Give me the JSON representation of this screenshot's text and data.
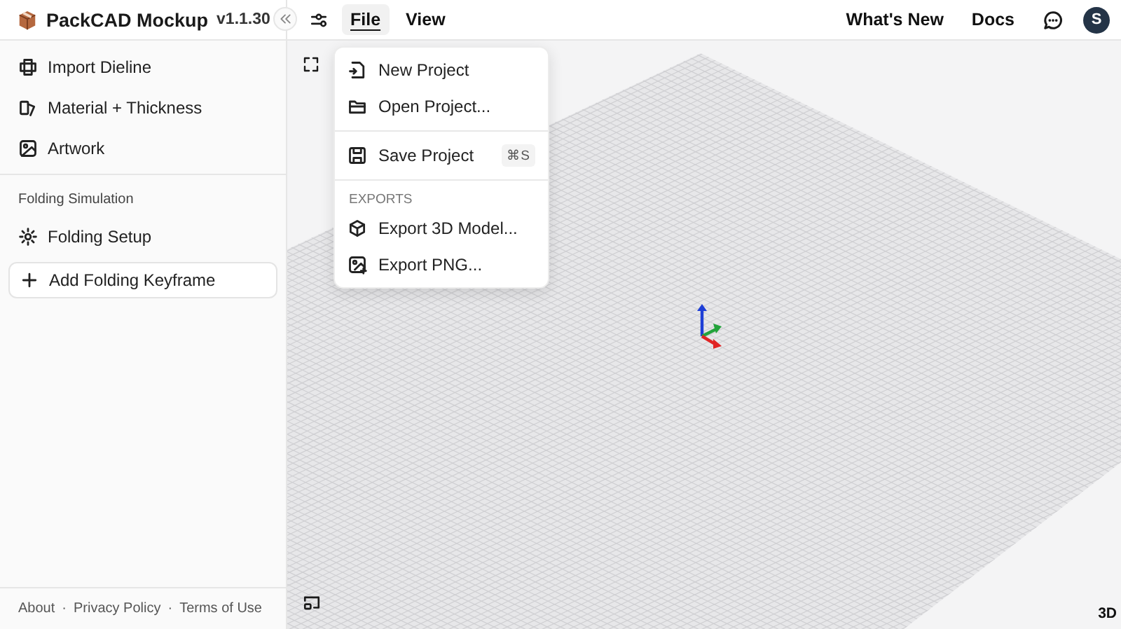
{
  "app": {
    "name": "PackCAD Mockup",
    "version": "v1.1.30"
  },
  "menubar": [
    {
      "label": "File",
      "selected": true
    },
    {
      "label": "View",
      "selected": false
    }
  ],
  "header_links": [
    "What's New",
    "Docs"
  ],
  "avatar": "S",
  "sidebar": {
    "items": [
      {
        "label": "Import Dieline"
      },
      {
        "label": "Material + Thickness"
      },
      {
        "label": "Artwork"
      }
    ],
    "section": "Folding Simulation",
    "section_items": [
      {
        "label": "Folding Setup"
      }
    ],
    "add_button": "Add Folding Keyframe",
    "footer": {
      "links": [
        "About",
        "Privacy Policy",
        "Terms of Use"
      ],
      "separator": "·"
    }
  },
  "file_menu": [
    {
      "kind": "item",
      "label": "New Project"
    },
    {
      "kind": "item",
      "label": "Open Project..."
    },
    {
      "kind": "separator"
    },
    {
      "kind": "item",
      "label": "Save Project",
      "shortcut": "⌘S"
    },
    {
      "kind": "separator"
    },
    {
      "kind": "heading",
      "label": "EXPORTS"
    },
    {
      "kind": "item",
      "label": "Export 3D Model..."
    },
    {
      "kind": "item",
      "label": "Export PNG..."
    }
  ],
  "viewport": {
    "mode": "3D"
  }
}
